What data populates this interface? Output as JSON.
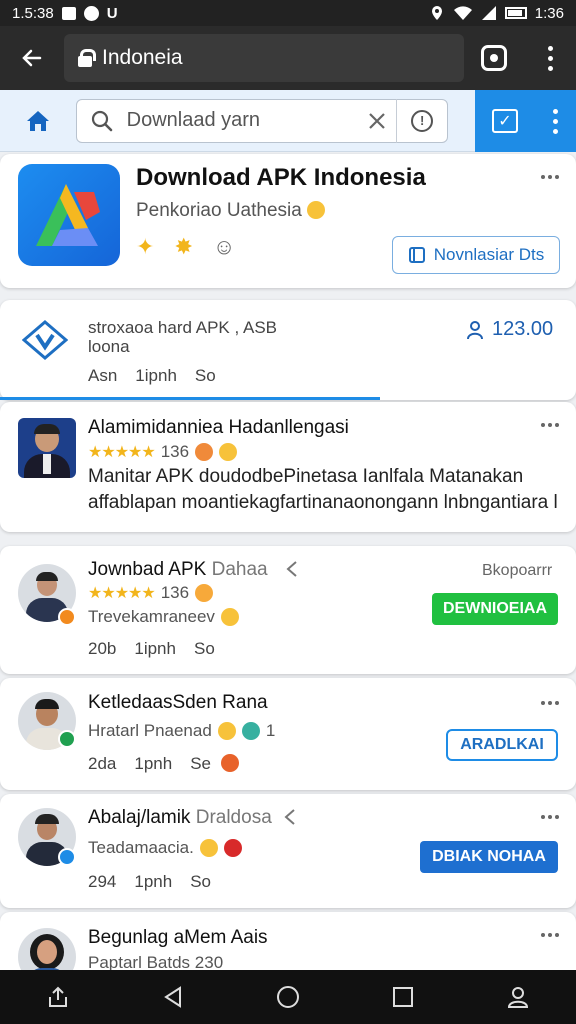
{
  "status_bar": {
    "time_left": "1.5:38",
    "time_right": "1:36"
  },
  "browser": {
    "url": "Indoneia"
  },
  "toolbar": {
    "search_placeholder": "Downlaad yarn"
  },
  "hero": {
    "title": "Download APK Indonesia",
    "subtitle": "Penkoriao Uathesia",
    "button_label": "Novnlasiar Dts"
  },
  "info_card": {
    "line1": "stroxaoa hard APK , ASB",
    "line2": "loona",
    "meta": [
      "Asn",
      "1ipnh",
      "So"
    ],
    "count": "123.00"
  },
  "featured": {
    "title": "Alamimidanniea Hadanllengasi",
    "rating_count": "136",
    "desc1": "Manitar APK doudodbePinetasa Ianlfala Matanakan",
    "desc2": "affablapan moantiekagfartinanaonongann lnbngantiara l.."
  },
  "list": [
    {
      "name": "Jownbad APK",
      "name_light": "Dahaa",
      "right_label": "Bkopoarrr",
      "rating_count": "136",
      "sub": "Trevekamraneev",
      "meta": [
        "20b",
        "1ipnh",
        "So"
      ],
      "button": "DEWNIOEIAA"
    },
    {
      "name": "KetledaasSden Rana",
      "sub": "Hratarl Pnaenad",
      "sub_number": "1",
      "meta": [
        "2da",
        "1pnh",
        "Se"
      ],
      "button": "ARADLKAI"
    },
    {
      "name": "Abalaj/lamik",
      "name_light": "Draldosa",
      "sub": "Teadamaacia.",
      "meta": [
        "294",
        "1pnh",
        "So"
      ],
      "button": "DBIAK NOHAA"
    },
    {
      "name": "Begunlag aMem Aais",
      "sub": "Paptarl Batds 230"
    }
  ],
  "colors": {
    "accent_blue": "#1e8ce6",
    "green_button": "#20c040",
    "star": "#f2b51c"
  }
}
